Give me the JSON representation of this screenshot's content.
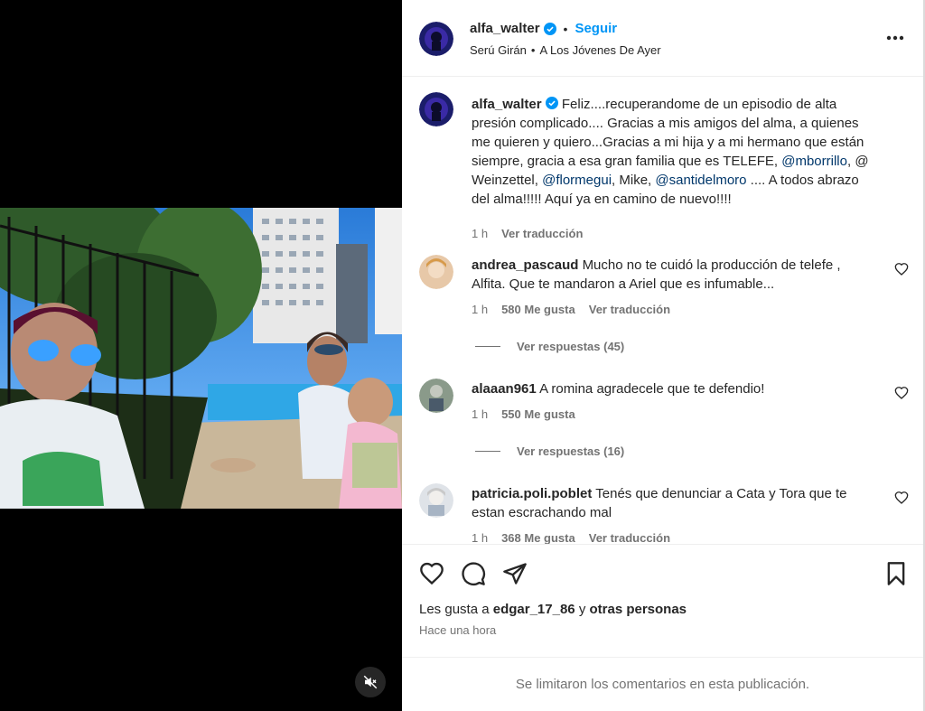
{
  "post": {
    "author": "alfa_walter",
    "follow_label": "Seguir",
    "dot": "•",
    "audio_artist": "Serú Girán",
    "audio_song": "A Los Jóvenes De Ayer",
    "caption_pre": "Feliz....recuperandome de un episodio de alta presión complicado.... Gracias a mis amigos del alma, a quienes me quieren y quiero...Gracias a mi hija y a mi hermano que están siempre, gracia a esa gran familia que es TELEFE,",
    "mention1": "@mborrillo",
    "caption_mid1": ", @ Weinzettel,",
    "mention2": "@flormegui",
    "caption_mid2": ", Mike,",
    "mention3": "@santidelmoro",
    "caption_post": ".... A todos abrazo del alma!!!!! Aquí ya en camino de nuevo!!!!",
    "caption_time": "1 h",
    "caption_translate": "Ver traducción"
  },
  "comments": [
    {
      "user": "andrea_pascaud",
      "text": "Mucho no te cuidó la producción de telefe , Alfita. Que te mandaron a Ariel que es infumable...",
      "time": "1 h",
      "likes": "580 Me gusta",
      "translate": "Ver traducción",
      "replies": "Ver respuestas (45)"
    },
    {
      "user": "alaaan961",
      "text": "A romina agradecele que te defendio!",
      "time": "1 h",
      "likes": "550 Me gusta",
      "replies": "Ver respuestas (16)"
    },
    {
      "user": "patricia.poli.poblet",
      "text": "Tenés que denunciar a Cata y Tora que te estan escrachando mal",
      "time": "1 h",
      "likes": "368 Me gusta",
      "translate": "Ver traducción"
    }
  ],
  "likes_line": {
    "prefix": "Les gusta a",
    "user": "edgar_17_86",
    "joiner": "y",
    "others": "otras personas"
  },
  "timestamp": "Hace una hora",
  "footer_notice": "Se limitaron los comentarios en esta publicación.",
  "colors": {
    "accent": "#0095f6",
    "mention": "#00376b",
    "muted": "#737373",
    "verified": "#0095f6"
  },
  "icons": [
    "verified-icon",
    "more-options-icon",
    "heart-icon",
    "comment-icon",
    "share-icon",
    "save-icon",
    "mute-icon"
  ]
}
